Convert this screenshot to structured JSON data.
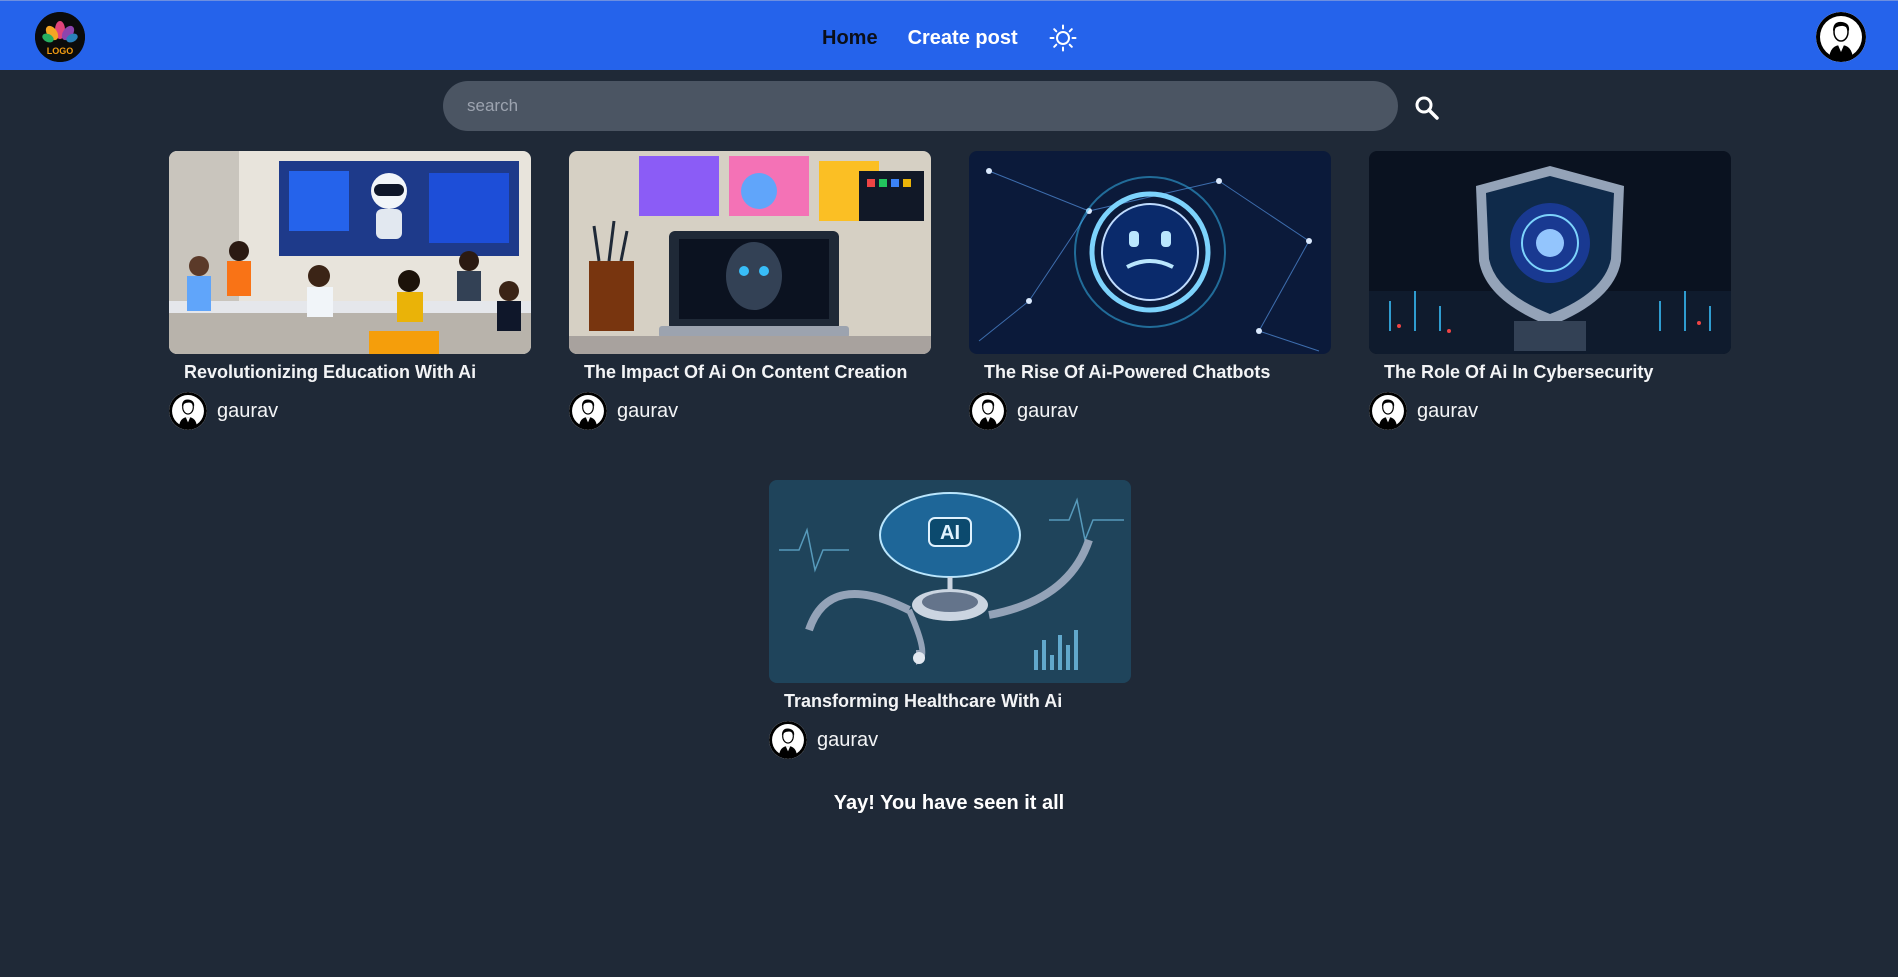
{
  "app": {
    "logo_text": "LOGO"
  },
  "nav": {
    "home_label": "Home",
    "create_label": "Create post",
    "theme_icon": "sun-icon",
    "accent_color": "#2563eb"
  },
  "search": {
    "placeholder": "search",
    "value": ""
  },
  "posts": [
    {
      "title": "Revolutionizing Education With Ai",
      "author": "gaurav"
    },
    {
      "title": "The Impact Of Ai On Content Creation",
      "author": "gaurav"
    },
    {
      "title": "The Rise Of Ai-Powered Chatbots",
      "author": "gaurav"
    },
    {
      "title": "The Role Of Ai In Cybersecurity",
      "author": "gaurav"
    },
    {
      "title": "Transforming Healthcare With Ai",
      "author": "gaurav",
      "image_label": "AI"
    }
  ],
  "footer": {
    "end_message": "Yay! You have seen it all"
  },
  "colors": {
    "background": "#1f2937",
    "search_bg": "#4b5563"
  }
}
